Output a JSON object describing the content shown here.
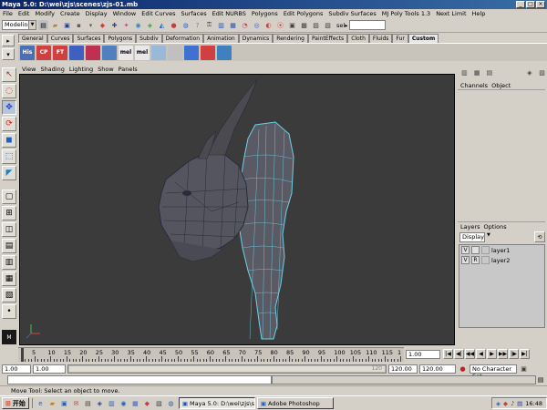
{
  "window": {
    "title": "Maya 5.0: D:\\wei\\zjs\\scenes\\zjs-01.mb"
  },
  "menu": [
    "File",
    "Edit",
    "Modify",
    "Create",
    "Display",
    "Window",
    "Edit Curves",
    "Surfaces",
    "Edit NURBS",
    "Polygons",
    "Edit Polygons",
    "Subdiv Surfaces",
    "MJ Poly Tools 1.3",
    "Next Limit",
    "Help"
  ],
  "status_line": {
    "mode": "Modeling",
    "sel_label": "sel▸"
  },
  "shelf_tabs": [
    "General",
    "Curves",
    "Surfaces",
    "Polygons",
    "Subdiv",
    "Deformation",
    "Animation",
    "Dynamics",
    "Rendering",
    "PaintEffects",
    "Cloth",
    "Fluids",
    "Fur",
    "Custom"
  ],
  "shelf_active": "Custom",
  "shelf_icons": [
    {
      "label": "His",
      "color": "#4a6fb5"
    },
    {
      "label": "CP",
      "color": "#d04040"
    },
    {
      "label": "FT",
      "color": "#d04040"
    },
    {
      "label": "",
      "color": "#4060c0"
    },
    {
      "label": "",
      "color": "#c03050"
    },
    {
      "label": "",
      "color": "#5080c0"
    },
    {
      "label": "mel",
      "color": "#e8e8e8"
    },
    {
      "label": "mel",
      "color": "#e8e8e8"
    },
    {
      "label": "",
      "color": "#9ab8d8"
    },
    {
      "label": "",
      "color": "#c0c0c0"
    },
    {
      "label": "",
      "color": "#4070d0"
    },
    {
      "label": "",
      "color": "#d04040"
    },
    {
      "label": "",
      "color": "#4080c0"
    }
  ],
  "panel_menu": [
    "View",
    "Shading",
    "Lighting",
    "Show",
    "Panels"
  ],
  "channel_box": {
    "tabs": [
      "Channels",
      "Object"
    ]
  },
  "layers": {
    "tabs": [
      "Layers",
      "Options"
    ],
    "display": "Display",
    "items": [
      {
        "v": "V",
        "r": "",
        "name": "layer1"
      },
      {
        "v": "V",
        "r": "R",
        "name": "layer2"
      }
    ]
  },
  "timeline": {
    "ticks": [
      "5",
      "10",
      "15",
      "20",
      "25",
      "30",
      "35",
      "40",
      "45",
      "50",
      "55",
      "60",
      "65",
      "70",
      "75",
      "80",
      "85",
      "90",
      "95",
      "100",
      "105",
      "110",
      "115",
      "1"
    ],
    "current_frame": "1.00"
  },
  "range": {
    "start": "1.00",
    "inner_start": "1.00",
    "inner_end": "120.00",
    "end": "120.00",
    "slider_mark": "120",
    "character_set": "No Character Set"
  },
  "help_line": "Move Tool: Select an object to move.",
  "taskbar": {
    "start": "开始",
    "tasks": [
      {
        "label": "Maya 5.0: D:\\wei\\zjs\\sce...",
        "active": true
      },
      {
        "label": "Adobe Photoshop",
        "active": false
      }
    ],
    "clock": "16:48"
  },
  "colors": {
    "viewport_bg": "#3b3b3b",
    "mesh_fill": "#5a5a64",
    "mesh_wire": "#6fd0e8",
    "titlebar": "#0a246a"
  }
}
